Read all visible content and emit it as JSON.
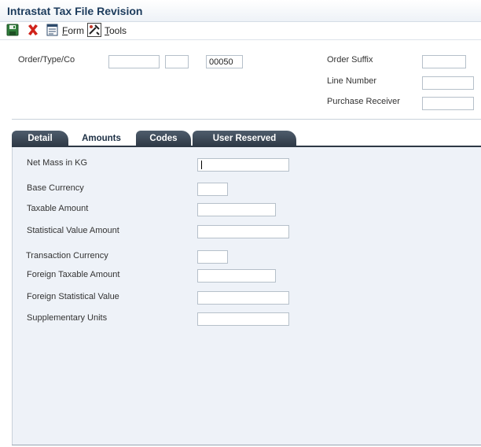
{
  "window": {
    "title": "Intrastat Tax File Revision"
  },
  "toolbar": {
    "save_icon": "save-icon",
    "delete_icon": "delete-icon",
    "form_icon": "form-icon",
    "form_label_key": "F",
    "form_label_rest": "orm",
    "tools_icon": "tools-icon",
    "tools_label_key": "T",
    "tools_label_rest": "ools"
  },
  "header": {
    "order_type_co_label": "Order/Type/Co",
    "order_number_value": "",
    "order_type_value": "",
    "order_company_value": "00050",
    "order_suffix_label": "Order Suffix",
    "order_suffix_value": "",
    "line_number_label": "Line Number",
    "line_number_value": "",
    "purchase_receiver_label": "Purchase Receiver",
    "purchase_receiver_value": ""
  },
  "tabs": [
    {
      "label": "Detail",
      "active": false
    },
    {
      "label": "Amounts",
      "active": true
    },
    {
      "label": "Codes",
      "active": false
    },
    {
      "label": "User Reserved",
      "active": false
    }
  ],
  "amounts": {
    "net_mass_label": "Net Mass in KG",
    "net_mass_value": "",
    "base_currency_label": "Base Currency",
    "base_currency_value": "",
    "taxable_amount_label": "Taxable Amount",
    "taxable_amount_value": "",
    "statistical_value_label": "Statistical Value Amount",
    "statistical_value_value": "",
    "transaction_currency_label": "Transaction Currency",
    "transaction_currency_value": "",
    "foreign_taxable_label": "Foreign Taxable Amount",
    "foreign_taxable_value": "",
    "foreign_statistical_label": "Foreign Statistical Value",
    "foreign_statistical_value": "",
    "supplementary_units_label": "Supplementary Units",
    "supplementary_units_value": ""
  },
  "colors": {
    "title_text": "#1c3b5c",
    "tab_dark": "#2e3946",
    "content_bg": "#eef2f8",
    "delete_red": "#d0231b"
  }
}
